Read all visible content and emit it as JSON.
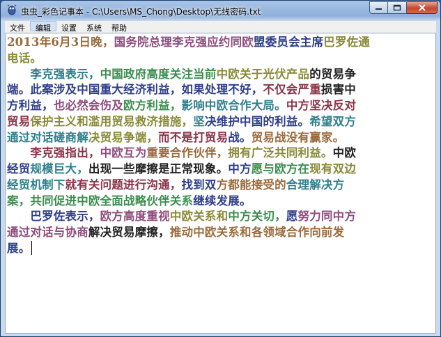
{
  "window": {
    "title": "虫虫_彩色记事本 - C:\\Users\\MS_Chong\\Desktop\\无线密码.txt"
  },
  "menu": {
    "items": [
      "文件",
      "编辑",
      "设置",
      "系统",
      "帮助"
    ],
    "active_index": 1
  },
  "colors": {
    "brown": "#9a6b3e",
    "plum": "#8e4d7e",
    "navy": "#2f3f8a",
    "teal": "#2f7f8c",
    "green": "#3c8e4f",
    "olive": "#8a8a3a",
    "maroon": "#8a3548",
    "black": "#222222"
  },
  "document": {
    "lines": [
      [
        [
          "2013年6月3日晚，",
          "brown"
        ],
        [
          "国务院总理李克强应约同欧",
          "plum"
        ],
        [
          "盟委员会主席",
          "navy"
        ],
        [
          "巴罗佐通",
          "olive"
        ]
      ],
      [
        [
          "电话。",
          "olive"
        ]
      ],
      [
        [
          "　　李克强表示，",
          "teal"
        ],
        [
          "中国政府高度关注当前",
          "green"
        ],
        [
          "中欧关于光伏产品",
          "olive"
        ],
        [
          "的贸易争",
          "black"
        ]
      ],
      [
        [
          "端。此案涉及中国重大经济利益，",
          "navy"
        ],
        [
          "如果处理不好，",
          "navy"
        ],
        [
          "不仅会严重",
          "maroon"
        ],
        [
          "损害中",
          "black"
        ]
      ],
      [
        [
          "方利益，",
          "navy"
        ],
        [
          "也必然会伤及",
          "plum"
        ],
        [
          "欧方利益，",
          "green"
        ],
        [
          "影响中欧合作大局。",
          "teal"
        ],
        [
          "中方坚决反对",
          "maroon"
        ]
      ],
      [
        [
          "贸易",
          "maroon"
        ],
        [
          "保护主义和滥用贸易救济措施，",
          "olive"
        ],
        [
          "坚",
          "teal"
        ],
        [
          "决维护中国的利益。",
          "navy"
        ],
        [
          "希望双方",
          "teal"
        ]
      ],
      [
        [
          "通过对话磋商解",
          "teal"
        ],
        [
          "决贸易争端，",
          "olive"
        ],
        [
          "而不是打贸易",
          "maroon"
        ],
        [
          "战。",
          "navy"
        ],
        [
          "贸易战没有赢家。",
          "brown"
        ]
      ],
      [
        [
          "　　李克强指出，",
          "maroon"
        ],
        [
          "中欧互为",
          "plum"
        ],
        [
          "重要合作伙伴，",
          "brown"
        ],
        [
          "拥有广泛共同利益。",
          "olive"
        ],
        [
          "中欧",
          "black"
        ]
      ],
      [
        [
          "经贸",
          "navy"
        ],
        [
          "规模巨大，",
          "teal"
        ],
        [
          "出现一些摩擦是正常现象。",
          "black"
        ],
        [
          "中方",
          "navy"
        ],
        [
          "愿与欧方在",
          "green"
        ],
        [
          "现有双边",
          "olive"
        ]
      ],
      [
        [
          "经贸机制下",
          "teal"
        ],
        [
          "就有关问题进行沟通，",
          "maroon"
        ],
        [
          "找到双",
          "navy"
        ],
        [
          "方都能接受的",
          "brown"
        ],
        [
          "合理解决方",
          "teal"
        ]
      ],
      [
        [
          "案，共同促进中欧全面战略伙伴关系",
          "green"
        ],
        [
          "继续发展。",
          "navy"
        ]
      ],
      [
        [
          "　　巴罗佐表示，",
          "navy"
        ],
        [
          "欧方高度重视",
          "plum"
        ],
        [
          "中欧关系和",
          "olive"
        ],
        [
          "中方关切，",
          "green"
        ],
        [
          "愿",
          "navy"
        ],
        [
          "努力同中方",
          "plum"
        ]
      ],
      [
        [
          "通过对话与协商",
          "plum"
        ],
        [
          "解决贸易摩擦，",
          "black"
        ],
        [
          "推动中欧关系和各领域合作向前发",
          "brown"
        ]
      ],
      [
        [
          "展。",
          "navy"
        ]
      ]
    ]
  }
}
